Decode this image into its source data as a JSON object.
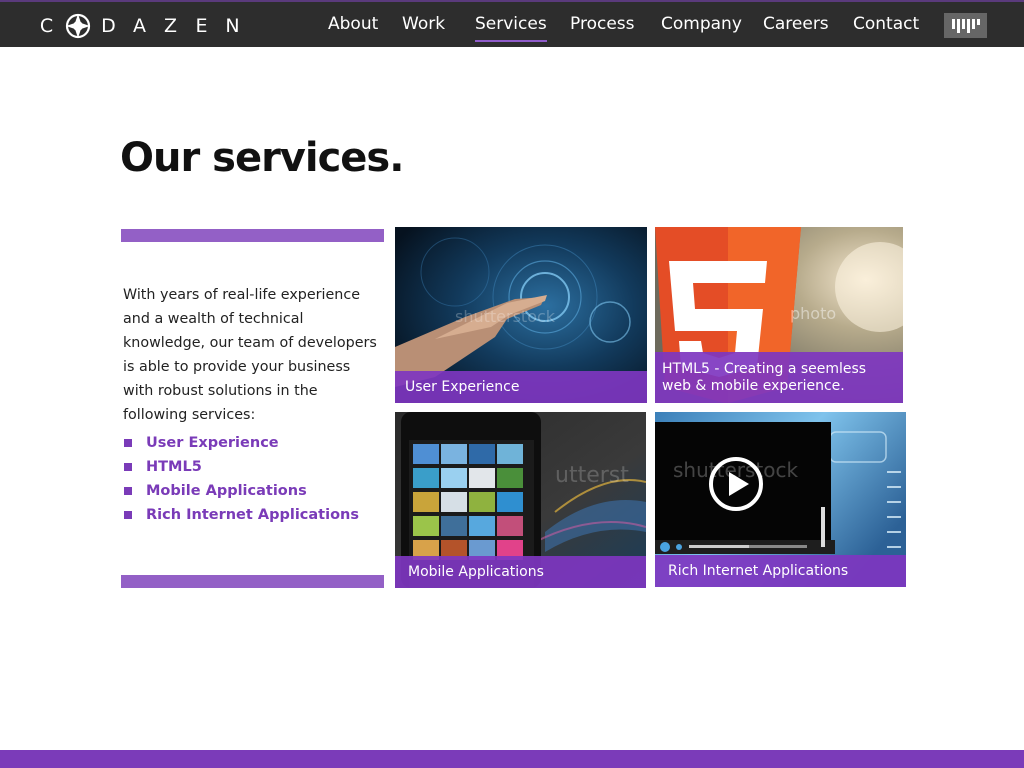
{
  "brand": {
    "name_letters": [
      "C",
      "D",
      "A",
      "Z",
      "E",
      "N"
    ],
    "accent": "#7b3bb9",
    "nav_bg": "#2d2d2d"
  },
  "nav": {
    "items": [
      {
        "label": "About"
      },
      {
        "label": "Work"
      },
      {
        "label": "Services",
        "active": true
      },
      {
        "label": "Process"
      },
      {
        "label": "Company"
      },
      {
        "label": "Careers"
      },
      {
        "label": "Contact"
      }
    ],
    "badge_icon": "barcode-logo-icon"
  },
  "main": {
    "title": "Our services.",
    "intro": "With years of real-life experience and a wealth of technical knowledge, our team of developers is able to provide your business with robust solutions in the following services:",
    "services": [
      "User Experience",
      "HTML5",
      "Mobile Applications",
      "Rich Internet Applications"
    ]
  },
  "tiles": [
    {
      "caption": "User Experience",
      "icon": "touch-interface-image"
    },
    {
      "caption": "HTML5 - Creating a seemless web & mobile experience.",
      "icon": "html5-logo-image"
    },
    {
      "caption": "Mobile Applications",
      "icon": "smartphone-app-grid-image"
    },
    {
      "caption": "Rich Internet Applications",
      "icon": "video-player-image"
    }
  ]
}
